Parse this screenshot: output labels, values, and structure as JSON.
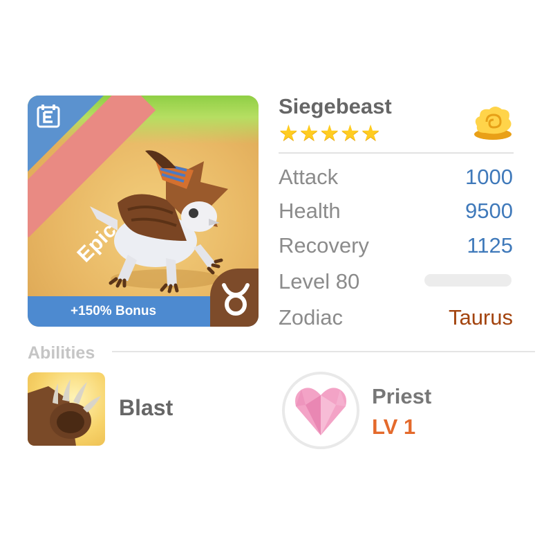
{
  "card": {
    "rarity": "Epic",
    "bonus": "+150% Bonus",
    "edit_icon": "e-icon",
    "zodiac_icon": "taurus-icon"
  },
  "creature": {
    "name": "Siegebeast",
    "stars": 5,
    "currency_icon": "gold-cloud-icon"
  },
  "stats": {
    "attack_label": "Attack",
    "attack_value": "1000",
    "health_label": "Health",
    "health_value": "9500",
    "recovery_label": "Recovery",
    "recovery_value": "1125",
    "level_label": "Level 80",
    "zodiac_label": "Zodiac",
    "zodiac_value": "Taurus"
  },
  "abilities": {
    "header": "Abilities",
    "skill": {
      "name": "Blast",
      "icon": "paw-claw-icon"
    },
    "class": {
      "name": "Priest",
      "level": "LV 1",
      "icon": "heart-icon"
    }
  },
  "colors": {
    "stat_value": "#3f79ba",
    "zodiac_value": "#a3440f",
    "class_level": "#e46a2c",
    "bonus_bar": "#4d8ad0",
    "epic_ribbon": "#e98a83"
  }
}
